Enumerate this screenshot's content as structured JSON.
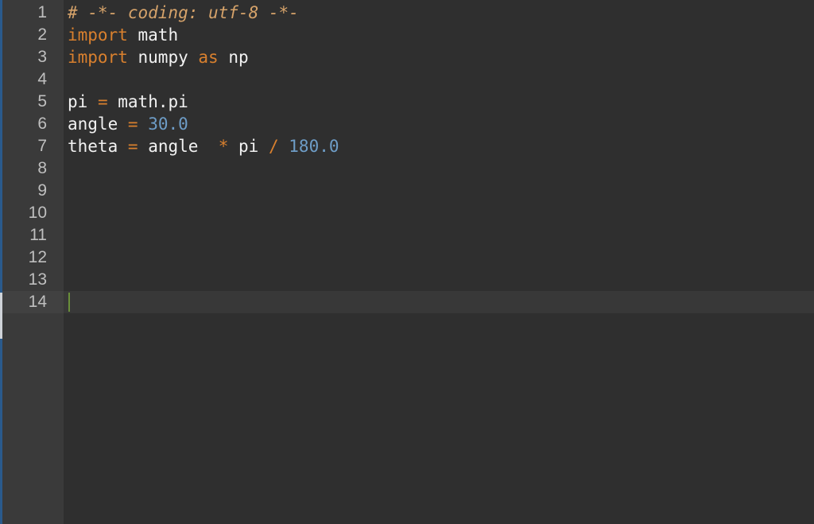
{
  "colors": {
    "background": "#2f2f2f",
    "gutter": "#3a3a3a",
    "line_number": "#bfbfbf",
    "keyword": "#d9802e",
    "comment": "#d6a36a",
    "number": "#6e9dc7",
    "text": "#f2f2f2",
    "caret": "#6a8f3a"
  },
  "editor": {
    "current_line": 14,
    "line_numbers": [
      "1",
      "2",
      "3",
      "4",
      "5",
      "6",
      "7",
      "8",
      "9",
      "10",
      "11",
      "12",
      "13",
      "14"
    ],
    "lines": [
      {
        "tokens": [
          {
            "t": "# -*- coding: utf-8 -*-",
            "k": "comment"
          }
        ]
      },
      {
        "tokens": [
          {
            "t": "import",
            "k": "keyword"
          },
          {
            "t": " ",
            "k": "name"
          },
          {
            "t": "math",
            "k": "name"
          }
        ]
      },
      {
        "tokens": [
          {
            "t": "import",
            "k": "keyword"
          },
          {
            "t": " ",
            "k": "name"
          },
          {
            "t": "numpy",
            "k": "name"
          },
          {
            "t": " ",
            "k": "name"
          },
          {
            "t": "as",
            "k": "keyword"
          },
          {
            "t": " ",
            "k": "name"
          },
          {
            "t": "np",
            "k": "name"
          }
        ]
      },
      {
        "tokens": []
      },
      {
        "tokens": [
          {
            "t": "pi",
            "k": "name"
          },
          {
            "t": " ",
            "k": "name"
          },
          {
            "t": "=",
            "k": "op"
          },
          {
            "t": " ",
            "k": "name"
          },
          {
            "t": "math.pi",
            "k": "name"
          }
        ]
      },
      {
        "tokens": [
          {
            "t": "angle",
            "k": "name"
          },
          {
            "t": " ",
            "k": "name"
          },
          {
            "t": "=",
            "k": "op"
          },
          {
            "t": " ",
            "k": "name"
          },
          {
            "t": "30.0",
            "k": "num"
          }
        ]
      },
      {
        "tokens": [
          {
            "t": "theta",
            "k": "name"
          },
          {
            "t": " ",
            "k": "name"
          },
          {
            "t": "=",
            "k": "op"
          },
          {
            "t": " ",
            "k": "name"
          },
          {
            "t": "angle",
            "k": "name"
          },
          {
            "t": "  ",
            "k": "name"
          },
          {
            "t": "*",
            "k": "op"
          },
          {
            "t": " ",
            "k": "name"
          },
          {
            "t": "pi",
            "k": "name"
          },
          {
            "t": " ",
            "k": "name"
          },
          {
            "t": "/",
            "k": "op"
          },
          {
            "t": " ",
            "k": "name"
          },
          {
            "t": "180.0",
            "k": "num"
          }
        ]
      },
      {
        "tokens": []
      },
      {
        "tokens": []
      },
      {
        "tokens": []
      },
      {
        "tokens": []
      },
      {
        "tokens": []
      },
      {
        "tokens": []
      },
      {
        "tokens": []
      }
    ]
  }
}
